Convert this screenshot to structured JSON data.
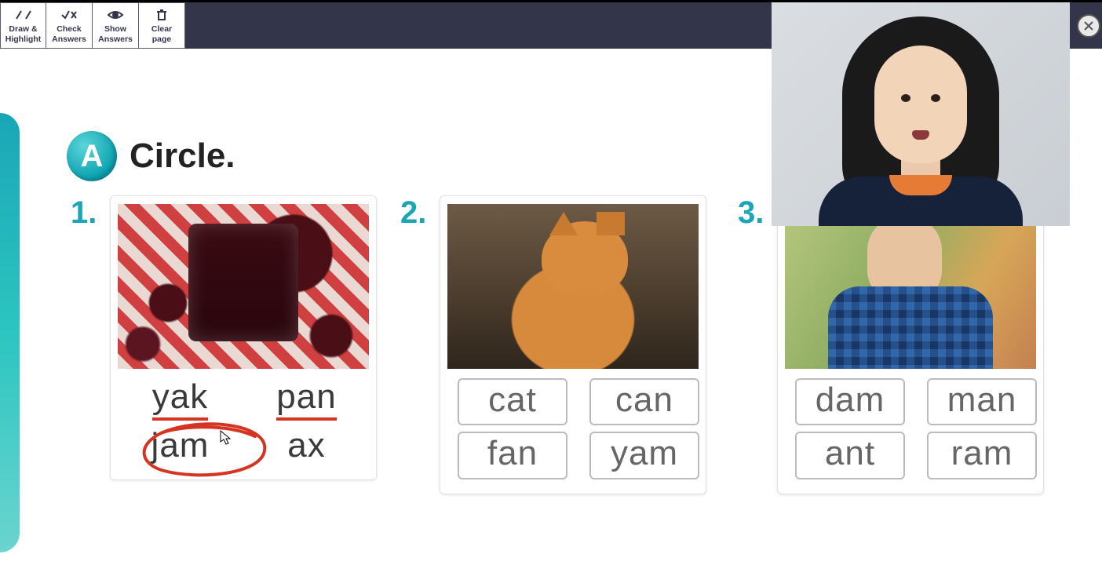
{
  "toolbar": {
    "buttons": [
      {
        "name": "draw-highlight-button",
        "label": "Draw &\nHighlight",
        "icon": "pencil-icon"
      },
      {
        "name": "check-answers-button",
        "label": "Check\nAnswers",
        "icon": "check-x-icon"
      },
      {
        "name": "show-answers-button",
        "label": "Show\nAnswers",
        "icon": "eye-icon"
      },
      {
        "name": "clear-page-button",
        "label": "Clear\npage",
        "icon": "trash-icon"
      }
    ]
  },
  "section": {
    "badge": "A",
    "title": "Circle."
  },
  "questions": [
    {
      "number": "1.",
      "image": "jam-jar-with-cherries",
      "words": [
        "yak",
        "pan",
        "jam",
        "ax"
      ],
      "annotations": {
        "underlined": [
          "yak",
          "pan"
        ],
        "circled": [
          "jam"
        ]
      },
      "boxed": false
    },
    {
      "number": "2.",
      "image": "orange-cat",
      "words": [
        "cat",
        "can",
        "fan",
        "yam"
      ],
      "annotations": {},
      "boxed": true
    },
    {
      "number": "3.",
      "image": "man-in-plaid-shirt",
      "words": [
        "dam",
        "man",
        "ant",
        "ram"
      ],
      "annotations": {},
      "boxed": true
    }
  ],
  "colors": {
    "accent_teal": "#1aa6b7",
    "annotation_red": "#d43421"
  }
}
